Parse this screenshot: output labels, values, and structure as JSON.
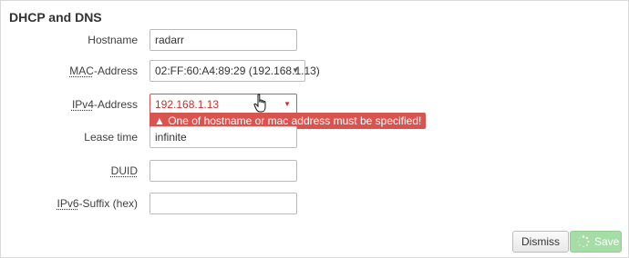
{
  "section": {
    "title": "DHCP and DNS"
  },
  "fields": {
    "hostname": {
      "label": "Hostname",
      "value": "radarr"
    },
    "mac": {
      "label": "MAC-Address",
      "value": "02:FF:60:A4:89:29 (192.168.1.13)"
    },
    "ipv4": {
      "label": "IPv4-Address",
      "value": "192.168.1.13"
    },
    "ipv4_error": "▲ One of hostname or mac address must be specified!",
    "lease": {
      "label": "Lease time",
      "value": "infinite"
    },
    "duid": {
      "label": "DUID",
      "value": ""
    },
    "ipv6": {
      "label_prefix": "IPv6",
      "label_suffix": "-Suffix (hex)",
      "value": ""
    }
  },
  "buttons": {
    "dismiss": "Dismiss",
    "save": "Save"
  },
  "colors": {
    "error": "#d9534f",
    "save": "#a6dca6",
    "border": "#bbbbbb"
  },
  "icons": {
    "select_caret": "caret-down-icon",
    "cursor": "hand-pointer-icon",
    "spinner": "loading-spinner-icon"
  }
}
